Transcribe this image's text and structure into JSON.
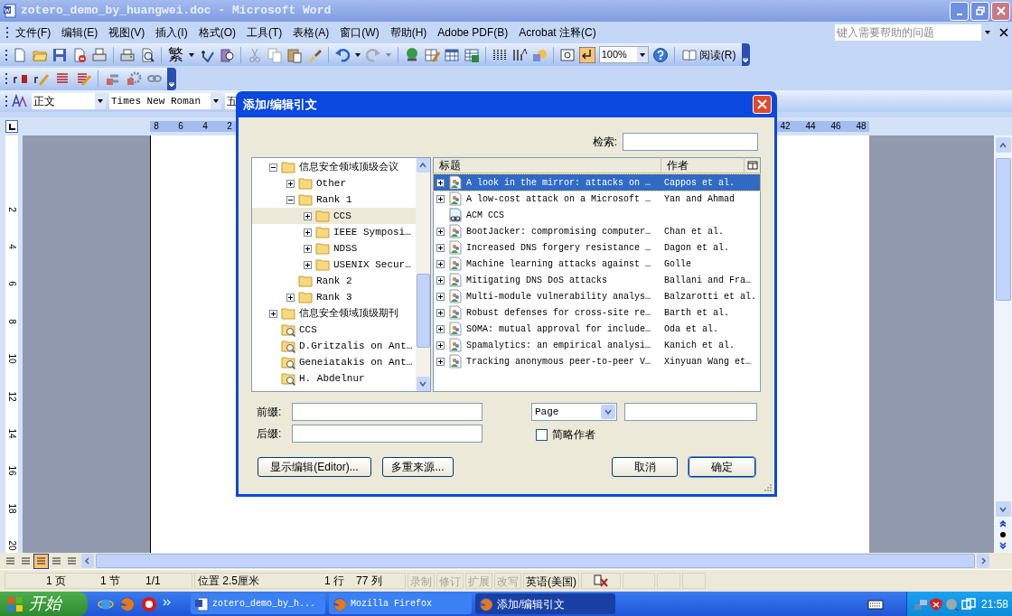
{
  "window": {
    "title": "zotero_demo_by_huangwei.doc - Microsoft Word"
  },
  "menu_bar": {
    "items": [
      "文件(F)",
      "编辑(E)",
      "视图(V)",
      "插入(I)",
      "格式(O)",
      "工具(T)",
      "表格(A)",
      "窗口(W)",
      "帮助(H)",
      "Adobe PDF(B)",
      "Acrobat 注释(C)"
    ],
    "help_box": {
      "placeholder": "键入需要帮助的问题"
    }
  },
  "standard_toolbar": {
    "traditional_button": "繁",
    "zoom": "100%",
    "read_button": "阅读(R)"
  },
  "formatting_toolbar": {
    "style": "正文",
    "font": "Times New Roman",
    "size": "五"
  },
  "horizontal_ruler": {
    "left_numbers": [
      "8",
      "6",
      "4",
      "2"
    ],
    "right_numbers": [
      "42",
      "44",
      "46",
      "48"
    ]
  },
  "vertical_ruler": {
    "numbers": [
      "2",
      "4",
      "6",
      "8",
      "10",
      "12",
      "14",
      "16",
      "18",
      "20"
    ]
  },
  "dialog": {
    "title": "添加/编辑引文",
    "search_label": "检索:",
    "collections": [
      {
        "label": "信息安全领域顶级会议",
        "kind": "folder",
        "expanded": true,
        "selected": false,
        "children": [
          {
            "label": "Other",
            "kind": "folder",
            "expanded": false,
            "selected": false
          },
          {
            "label": "Rank 1",
            "kind": "folder",
            "expanded": true,
            "selected": false,
            "children": [
              {
                "label": "CCS",
                "kind": "folder",
                "expanded": false,
                "selected": true
              },
              {
                "label": "IEEE Symposi…",
                "kind": "folder",
                "expanded": false,
                "selected": false
              },
              {
                "label": "NDSS",
                "kind": "folder",
                "expanded": false,
                "selected": false
              },
              {
                "label": "USENIX Secur…",
                "kind": "folder",
                "expanded": false,
                "selected": false
              }
            ]
          },
          {
            "label": "Rank 2",
            "kind": "folder",
            "selected": false
          },
          {
            "label": "Rank 3",
            "kind": "folder",
            "expanded": false,
            "selected": false
          }
        ]
      },
      {
        "label": "信息安全领域顶级期刊",
        "kind": "folder",
        "expanded": false,
        "selected": false
      },
      {
        "label": "CCS",
        "kind": "saved_search",
        "selected": false
      },
      {
        "label": "D.Gritzalis on Ant…",
        "kind": "saved_search",
        "selected": false
      },
      {
        "label": "Geneiatakis on Ant…",
        "kind": "saved_search",
        "selected": false
      },
      {
        "label": "H. Abdelnur",
        "kind": "saved_search",
        "selected": false
      }
    ],
    "items": {
      "columns": [
        "标题",
        "作者"
      ],
      "rows": [
        {
          "kind": "item",
          "title": "A look in the mirror: attacks on …",
          "author": "Cappos et al.",
          "selected": true
        },
        {
          "kind": "item",
          "title": "A low-cost attack on a Microsoft …",
          "author": "Yan and Ahmad",
          "selected": false
        },
        {
          "kind": "link",
          "title": "ACM CCS",
          "selected": false
        },
        {
          "kind": "item",
          "title": "BootJacker: compromising computer…",
          "author": "Chan et al.",
          "selected": false
        },
        {
          "kind": "item",
          "title": "Increased DNS forgery resistance …",
          "author": "Dagon et al.",
          "selected": false
        },
        {
          "kind": "item",
          "title": "Machine learning attacks against …",
          "author": "Golle",
          "selected": false
        },
        {
          "kind": "item",
          "title": "Mitigating DNS DoS attacks",
          "author": "Ballani and Fra…",
          "selected": false
        },
        {
          "kind": "item",
          "title": "Multi-module vulnerability analys…",
          "author": "Balzarotti et al.",
          "selected": false
        },
        {
          "kind": "item",
          "title": "Robust defenses for cross-site re…",
          "author": "Barth et al.",
          "selected": false
        },
        {
          "kind": "item",
          "title": "SOMA: mutual approval for include…",
          "author": "Oda et al.",
          "selected": false
        },
        {
          "kind": "item",
          "title": "Spamalytics: an empirical analysi…",
          "author": "Kanich et al.",
          "selected": false
        },
        {
          "kind": "item",
          "title": "Tracking anonymous peer-to-peer V…",
          "author": "Xinyuan Wang et…",
          "selected": false
        }
      ]
    },
    "prefix_label": "前缀:",
    "suffix_label": "后缀:",
    "locator": "Page",
    "suppress_author": {
      "label": "简略作者",
      "checked": false
    },
    "buttons": {
      "show_editor": "显示编辑(Editor)...",
      "multiple_sources": "多重来源...",
      "cancel": "取消",
      "ok": "确定"
    }
  },
  "view_modes": [
    {
      "selected": false
    },
    {
      "selected": false
    },
    {
      "selected": true
    },
    {
      "selected": false
    },
    {
      "selected": false
    }
  ],
  "status_bar": {
    "position_info": [
      "1 页",
      "1 节",
      "1/1",
      "位置 2.5厘米",
      "1 行",
      "77 列"
    ],
    "modes": [
      {
        "label": "录制",
        "disabled": true
      },
      {
        "label": "修订",
        "disabled": true
      },
      {
        "label": "扩展",
        "disabled": true
      },
      {
        "label": "改写",
        "disabled": true
      }
    ],
    "language": "英语(美国)"
  },
  "taskbar": {
    "start": "开始",
    "tasks": [
      {
        "label": "zotero_demo_by_h...",
        "kind": "word",
        "selected": false
      },
      {
        "label": "Mozilla Firefox",
        "kind": "firefox",
        "selected": false
      },
      {
        "label": "添加/编辑引文",
        "kind": "firefox",
        "selected": true
      }
    ],
    "clock": "21:58"
  }
}
